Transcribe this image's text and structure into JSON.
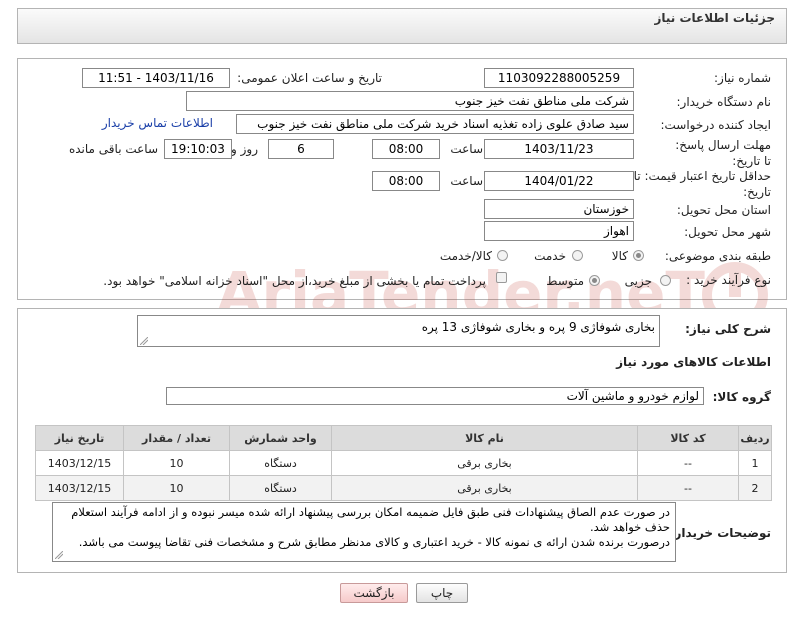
{
  "header": {
    "title": "جزئیات اطلاعات نیاز"
  },
  "form": {
    "need_number_label": "شماره نیاز:",
    "need_number": "1103092288005259",
    "announce_label": "تاریخ و ساعت اعلان عمومی:",
    "announce_value": "1403/11/16 - 11:51",
    "buyer_org_label": "نام دستگاه خریدار:",
    "buyer_org": "شرکت ملی مناطق نفت خیز جنوب",
    "requester_label": "ایجاد کننده درخواست:",
    "requester": "سید صادق علوی زاده  تغذیه اسناد خرید  شرکت ملی مناطق نفت خیز جنوب",
    "buyer_contact_link": "اطلاعات تماس خریدار",
    "deadline_label": "مهلت ارسال پاسخ: تا تاریخ:",
    "deadline_date": "1403/11/23",
    "time_label": "ساعت",
    "deadline_time": "08:00",
    "remaining_days": "6",
    "days_and_label": "روز و",
    "remaining_time": "19:10:03",
    "remaining_suffix": "ساعت باقی مانده",
    "price_validity_label": "حداقل تاریخ اعتبار قیمت: تا تاریخ:",
    "price_validity_date": "1404/01/22",
    "price_validity_time": "08:00",
    "province_label": "استان محل تحویل:",
    "province": "خوزستان",
    "city_label": "شهر محل تحویل:",
    "city": "اهواز",
    "category_label": "طبقه بندی موضوعی:",
    "category_options": [
      "کالا",
      "خدمت",
      "کالا/خدمت"
    ],
    "category_selected": "کالا",
    "process_label": "نوع فرآیند خرید :",
    "process_options": [
      "جزیی",
      "متوسط"
    ],
    "process_selected": "متوسط",
    "payment_note": "پرداخت تمام یا بخشی از مبلغ خرید،از محل \"اسناد خزانه اسلامی\" خواهد بود."
  },
  "details": {
    "summary_label": "شرح کلی نیاز:",
    "summary_value": "بخاری شوفاژی 9 پره و بخاری شوفاژی 13 پره",
    "goods_info_title": "اطلاعات کالاهای مورد نیاز",
    "goods_group_label": "گروه کالا:",
    "goods_group_value": "لوازم خودرو و ماشین آلات",
    "table": {
      "headers": [
        "ردیف",
        "کد کالا",
        "نام کالا",
        "واحد شمارش",
        "تعداد / مقدار",
        "تاریخ نیاز"
      ],
      "rows": [
        [
          "1",
          "--",
          "بخاری برقی",
          "دستگاه",
          "10",
          "1403/12/15"
        ],
        [
          "2",
          "--",
          "بخاری برقی",
          "دستگاه",
          "10",
          "1403/12/15"
        ]
      ]
    },
    "buyer_notes_label": "توضیحات خریدار:",
    "buyer_notes_line1": "در صورت عدم الصاق پیشنهادات فنی طبق فایل ضمیمه امکان بررسی پیشنهاد ارائه شده میسر نبوده و از ادامه فرآیند استعلام حذف خواهد شد.",
    "buyer_notes_line2": "درصورت برنده شدن ارائه ی نمونه کالا - خرید اعتباری و کالای مدنظر مطابق شرح و مشخصات فنی تقاضا پیوست می باشد."
  },
  "buttons": {
    "print": "چاپ",
    "back": "بازگشت"
  },
  "watermark": {
    "text": "AriaTender.neT",
    "color": "#c0392b"
  }
}
